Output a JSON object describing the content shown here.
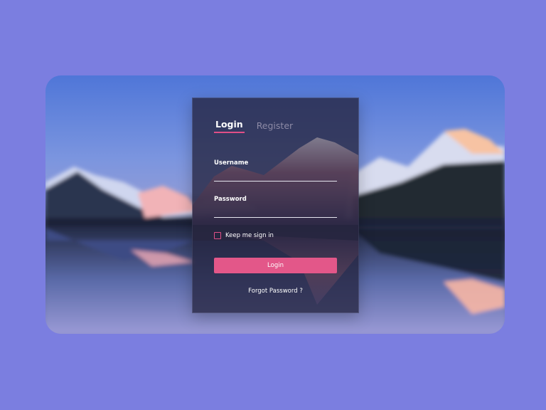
{
  "colors": {
    "page_background": "#7b7ee0",
    "accent": "#e35789",
    "panel": "rgba(40,40,70,0.62)"
  },
  "tabs": [
    {
      "label": "Login",
      "active": true
    },
    {
      "label": "Register",
      "active": false
    }
  ],
  "form": {
    "username_label": "Username",
    "username_value": "",
    "password_label": "Password",
    "password_value": "",
    "remember_label": "Keep me sign in",
    "remember_checked": false,
    "submit_label": "Login",
    "forgot_label": "Forgot Password ?"
  }
}
